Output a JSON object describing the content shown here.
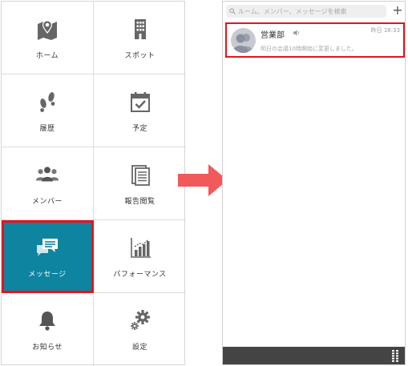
{
  "menu": {
    "tiles": [
      {
        "label": "ホーム",
        "icon": "map-pin-icon"
      },
      {
        "label": "スポット",
        "icon": "building-icon"
      },
      {
        "label": "履歴",
        "icon": "footprints-icon"
      },
      {
        "label": "予定",
        "icon": "calendar-check-icon"
      },
      {
        "label": "メンバー",
        "icon": "group-icon"
      },
      {
        "label": "報告閲覧",
        "icon": "document-icon"
      },
      {
        "label": "メッセージ",
        "icon": "chat-bubbles-icon",
        "active": true
      },
      {
        "label": "パフォーマンス",
        "icon": "bar-chart-icon"
      },
      {
        "label": "お知らせ",
        "icon": "bell-icon"
      },
      {
        "label": "設定",
        "icon": "gears-icon"
      }
    ]
  },
  "phone": {
    "search_placeholder": "ルーム、メンバー、メッセージを検索",
    "add_label": "+",
    "chat": {
      "name": "営業部",
      "time": "昨日 16:33",
      "preview": "明日の会議10時開始に変更しました。"
    }
  },
  "colors": {
    "accent": "#0e84a0",
    "highlight": "#e8121d",
    "arrow": "#f05a5a",
    "icon": "#555555",
    "bottom_bar": "#444444"
  }
}
